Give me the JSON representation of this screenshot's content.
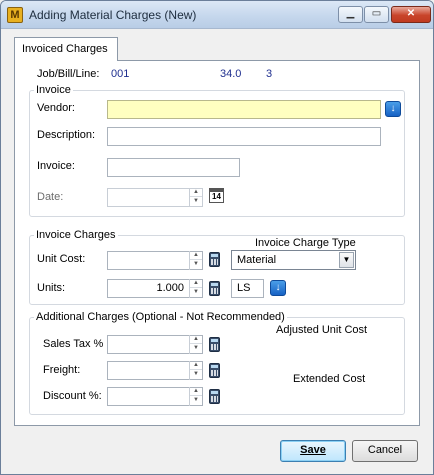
{
  "window": {
    "title": "Adding Material Charges  (New)",
    "app_icon_letter": "M",
    "min_glyph": "▁",
    "max_glyph": "▭",
    "close_glyph": "✕"
  },
  "tab": {
    "label": "Invoiced Charges"
  },
  "job": {
    "label": "Job/Bill/Line:",
    "job": "001",
    "bill": "34.0",
    "line": "3"
  },
  "invoice_group": {
    "legend": "Invoice",
    "vendor_label": "Vendor:",
    "vendor_value": "",
    "description_label": "Description:",
    "description_value": "",
    "invoice_label": "Invoice:",
    "invoice_value": "",
    "date_label": "Date:",
    "date_value": "",
    "calendar_glyph": "14"
  },
  "charges_group": {
    "legend": "Invoice Charges",
    "type_label": "Invoice Charge Type",
    "unit_cost_label": "Unit Cost:",
    "unit_cost_value": "",
    "units_label": "Units:",
    "units_value": "1.000",
    "unit_of_measure": "LS",
    "charge_type_selected": "Material"
  },
  "additional_group": {
    "legend": "Additional Charges (Optional - Not Recommended)",
    "sales_tax_label": "Sales Tax %",
    "sales_tax_value": "",
    "freight_label": "Freight:",
    "freight_value": "",
    "discount_label": "Discount %:",
    "discount_value": "",
    "adjusted_unit_cost_label": "Adjusted Unit Cost",
    "extended_cost_label": "Extended Cost"
  },
  "buttons": {
    "save": "Save",
    "cancel": "Cancel"
  },
  "glyphs": {
    "spin_up": "▲",
    "spin_down": "▼",
    "dropdown": "▼",
    "lookup": "↓"
  }
}
